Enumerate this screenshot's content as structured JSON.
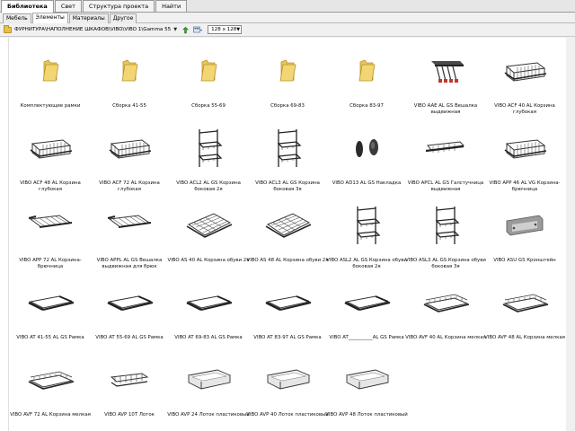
{
  "top_tabs": [
    "Библиотека",
    "Свет",
    "Структура проекта",
    "Найти"
  ],
  "sub_tabs": [
    "Мебель",
    "Элементы",
    "Материалы",
    "Другое"
  ],
  "toolbar": {
    "path": "ФУРНИТУРА\\НАПОЛНЕНИЕ ШКАФОВ\\VIBO\\VIBO 1\\Gamma 55",
    "size_value": "128 x 128"
  },
  "items": [
    {
      "label": "Комплектующие рамки",
      "icon": "folder-icon"
    },
    {
      "label": "Сборка 41-55",
      "icon": "folder-icon"
    },
    {
      "label": "Сборка 55-69",
      "icon": "folder-icon"
    },
    {
      "label": "Сборка 69-83",
      "icon": "folder-icon"
    },
    {
      "label": "Сборка 83-97",
      "icon": "folder-icon"
    },
    {
      "label": "VIBO AAE AL GS Вешалка выдвижная",
      "icon": "hanger-icon"
    },
    {
      "label": "VIBO ACF 40 AL Корзина глубокая",
      "icon": "basket-icon"
    },
    {
      "label": "VIBO ACF 48 AL Корзина глубокая",
      "icon": "basket-icon"
    },
    {
      "label": "VIBO ACF 72 AL Корзина глубокая",
      "icon": "basket-icon"
    },
    {
      "label": "VIBO ACL2 AL GS Корзина боковая 2я",
      "icon": "side-rack-icon"
    },
    {
      "label": "VIBO ACL3 AL GS Корзина боковая 3я",
      "icon": "side-rack-icon"
    },
    {
      "label": "VIBO AD13 AL GS Накладка",
      "icon": "cover-icon"
    },
    {
      "label": "VIBO APCL AL GS Галстучница выдвижная",
      "icon": "tie-rack-icon"
    },
    {
      "label": "VIBO APP 46 AL VG Корзина-брючница",
      "icon": "basket-icon"
    },
    {
      "label": "VIBO APP 72 AL Корзина-брючница",
      "icon": "pants-rack-icon"
    },
    {
      "label": "VIBO APPL AL GS Вешалка выдвижная для брюк",
      "icon": "pants-rack-icon"
    },
    {
      "label": "VIBO AS 40 AL Корзина обуви 2я",
      "icon": "shoe-rack-icon"
    },
    {
      "label": "VIBO AS 48 AL Корзина обуви 2я",
      "icon": "shoe-rack-icon"
    },
    {
      "label": "VIBO ASL2 AL GS Корзина обуви боковая 2я",
      "icon": "side-rack-icon"
    },
    {
      "label": "VIBO ASL3 AL GS Корзина обуви боковая 3я",
      "icon": "side-rack-icon"
    },
    {
      "label": "VIBO ASU GS Кронштейн",
      "icon": "bracket-icon"
    },
    {
      "label": "VIBO AT 41-55 AL GS Рамка",
      "icon": "frame-icon"
    },
    {
      "label": "VIBO AT 55-69 AL GS Рамка",
      "icon": "frame-icon"
    },
    {
      "label": "VIBO AT 69-83 AL GS Рамка",
      "icon": "frame-icon"
    },
    {
      "label": "VIBO AT 83-97 AL GS Рамка",
      "icon": "frame-icon"
    },
    {
      "label": "VIBO AT__________AL GS Рамка",
      "icon": "frame-icon"
    },
    {
      "label": "VIBO AVF 40 AL Корзина мелкая",
      "icon": "shallow-basket-icon"
    },
    {
      "label": "VIBO AVF 48 AL Корзина мелкая",
      "icon": "shallow-basket-icon"
    },
    {
      "label": "VIBO AVF 72 AL Корзина мелкая",
      "icon": "shallow-basket-icon"
    },
    {
      "label": "VIBO AVP 10T Лоток",
      "icon": "tray-icon"
    },
    {
      "label": "VIBO AVP 24 Лоток пластиковый",
      "icon": "plastic-tray-icon"
    },
    {
      "label": "VIBO AVP 40 Лоток пластиковый",
      "icon": "plastic-tray-icon"
    },
    {
      "label": "VIBO AVP 48 Лоток пластиковый",
      "icon": "plastic-tray-icon"
    }
  ]
}
